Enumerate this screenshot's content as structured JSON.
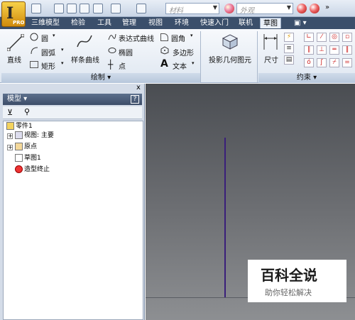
{
  "app": {
    "logo_letter": "I",
    "logo_sub": "PRO"
  },
  "quickbar": {
    "material": "材料",
    "appearance": "外观"
  },
  "tabs": [
    "三维模型",
    "检验",
    "工具",
    "管理",
    "视图",
    "环境",
    "快速入门",
    "联机",
    "草图"
  ],
  "active_tab": "草图",
  "ribbon": {
    "line": "直线",
    "circle": "圆",
    "arc": "圆弧",
    "rect": "矩形",
    "spline": "样条曲线",
    "eq_curve": "表达式曲线",
    "ellipse": "椭圆",
    "point": "点",
    "fillet": "圆角",
    "polygon": "多边形",
    "text": "文本",
    "project": "投影几何图元",
    "dimension": "尺寸",
    "draw_panel": "绘制",
    "constraint_panel": "约束"
  },
  "browser": {
    "title": "模型",
    "help": "?",
    "close": "x",
    "tree": [
      {
        "label": "零件1",
        "level": 0
      },
      {
        "label": "视图: 主要",
        "level": 1
      },
      {
        "label": "原点",
        "level": 1
      },
      {
        "label": "草图1",
        "level": 1
      },
      {
        "label": "造型终止",
        "level": 1
      }
    ]
  },
  "watermark": {
    "title": "百科全说",
    "subtitle": "助你轻松解决"
  }
}
